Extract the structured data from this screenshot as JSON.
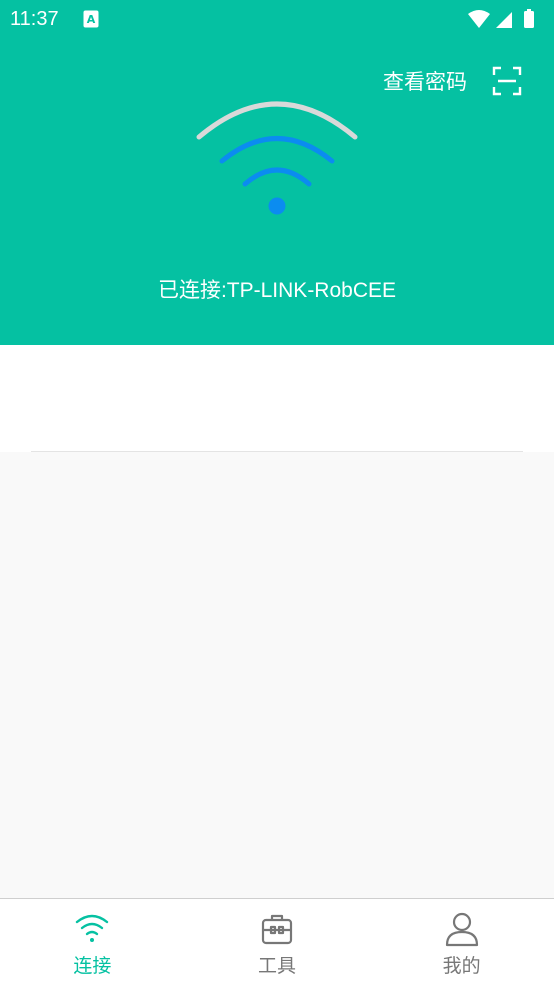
{
  "status_bar": {
    "time": "11:37",
    "notif_icon": "a-square-icon",
    "icons": [
      "wifi-signal-icon",
      "cell-signal-icon",
      "battery-icon"
    ]
  },
  "header": {
    "view_password_label": "查看密码",
    "scan_icon": "scan-icon",
    "connected_text": "已连接:TP-LINK-RobCEE",
    "accent_color": "#05c1a2",
    "wifi_active_color": "#0b8cf0",
    "wifi_inactive_color": "#d9d9d9"
  },
  "tabs": [
    {
      "label": "连接",
      "icon": "wifi-icon",
      "active": true
    },
    {
      "label": "工具",
      "icon": "toolbox-icon",
      "active": false
    },
    {
      "label": "我的",
      "icon": "user-icon",
      "active": false
    }
  ]
}
